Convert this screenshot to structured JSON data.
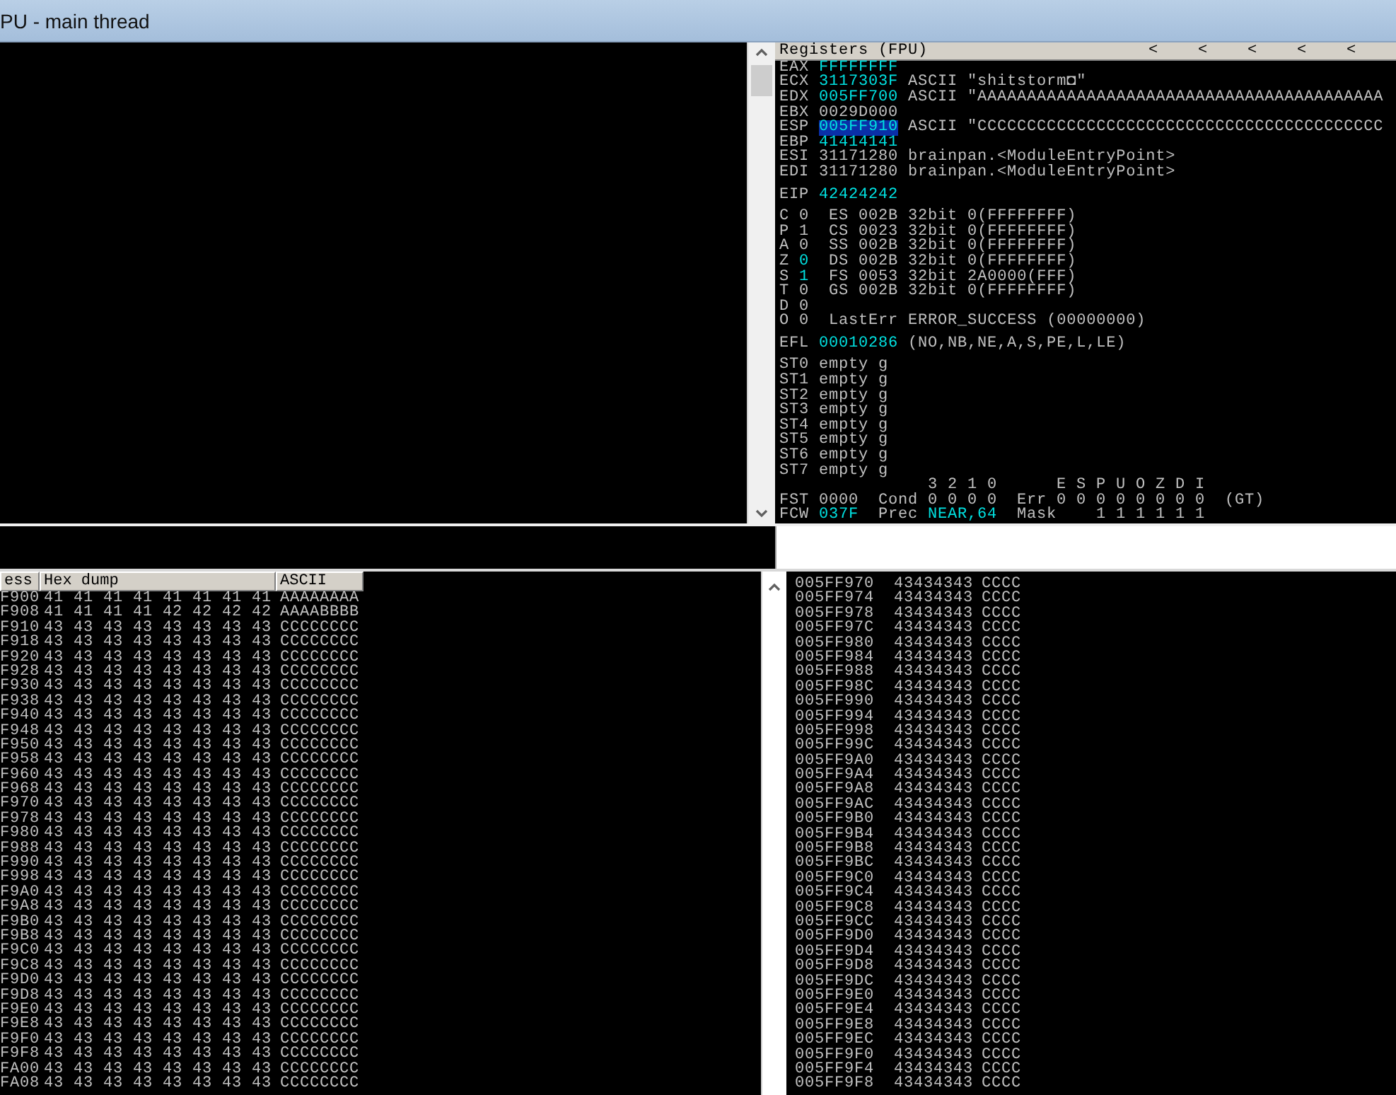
{
  "window": {
    "title": "PU - main thread"
  },
  "registers": {
    "title": "Registers (FPU)",
    "nav_buttons": [
      "<",
      "<",
      "<",
      "<",
      "<"
    ],
    "general": [
      {
        "name": "EAX",
        "value": "FFFFFFFF",
        "changed": true,
        "selected": false
      },
      {
        "name": "ECX",
        "value": "3117303F",
        "changed": true,
        "selected": false,
        "comment": "ASCII \"shitstorm◘\""
      },
      {
        "name": "EDX",
        "value": "005FF700",
        "changed": true,
        "selected": false,
        "comment": "ASCII \"AAAAAAAAAAAAAAAAAAAAAAAAAAAAAAAAAAAAAAAAA"
      },
      {
        "name": "EBX",
        "value": "0029D000",
        "changed": false,
        "selected": false
      },
      {
        "name": "ESP",
        "value": "005FF910",
        "changed": true,
        "selected": true,
        "comment": "ASCII \"CCCCCCCCCCCCCCCCCCCCCCCCCCCCCCCCCCCCCCCCC"
      },
      {
        "name": "EBP",
        "value": "41414141",
        "changed": true,
        "selected": false
      },
      {
        "name": "ESI",
        "value": "31171280",
        "changed": false,
        "selected": false,
        "comment": "brainpan.<ModuleEntryPoint>"
      },
      {
        "name": "EDI",
        "value": "31171280",
        "changed": false,
        "selected": false,
        "comment": "brainpan.<ModuleEntryPoint>"
      }
    ],
    "eip": {
      "name": "EIP",
      "value": "42424242",
      "changed": true
    },
    "flags": [
      {
        "name": "C",
        "value": "0",
        "changed": false,
        "detail": "ES 002B 32bit 0(FFFFFFFF)"
      },
      {
        "name": "P",
        "value": "1",
        "changed": false,
        "detail": "CS 0023 32bit 0(FFFFFFFF)"
      },
      {
        "name": "A",
        "value": "0",
        "changed": false,
        "detail": "SS 002B 32bit 0(FFFFFFFF)"
      },
      {
        "name": "Z",
        "value": "0",
        "changed": true,
        "detail": "DS 002B 32bit 0(FFFFFFFF)"
      },
      {
        "name": "S",
        "value": "1",
        "changed": true,
        "detail": "FS 0053 32bit 2A0000(FFF)"
      },
      {
        "name": "T",
        "value": "0",
        "changed": false,
        "detail": "GS 002B 32bit 0(FFFFFFFF)"
      },
      {
        "name": "D",
        "value": "0",
        "changed": false
      },
      {
        "name": "O",
        "value": "0",
        "changed": false,
        "detail": "LastErr ERROR_SUCCESS (00000000)"
      }
    ],
    "efl": {
      "name": "EFL",
      "value": "00010286",
      "changed": true,
      "decoded": "(NO,NB,NE,A,S,PE,L,LE)"
    },
    "fpu_stack": [
      {
        "name": "ST0",
        "text": "empty g"
      },
      {
        "name": "ST1",
        "text": "empty g"
      },
      {
        "name": "ST2",
        "text": "empty g"
      },
      {
        "name": "ST3",
        "text": "empty g"
      },
      {
        "name": "ST4",
        "text": "empty g"
      },
      {
        "name": "ST5",
        "text": "empty g"
      },
      {
        "name": "ST6",
        "text": "empty g"
      },
      {
        "name": "ST7",
        "text": "empty g"
      }
    ],
    "fpu_status": [
      {
        "segments": [
          {
            "text": "3 2 1 0",
            "changed": false
          },
          {
            "text": "E S P U O Z D I",
            "changed": false
          }
        ]
      },
      {
        "segments": [
          {
            "text": "FST",
            "changed": false
          },
          {
            "text": "0000",
            "changed": false
          },
          {
            "text": "Cond",
            "changed": false
          },
          {
            "text": "0 0 0 0",
            "changed": false
          },
          {
            "text": "Err",
            "changed": false
          },
          {
            "text": "0 0 0 0 0 0 0 0",
            "changed": false
          },
          {
            "text": "(GT)",
            "changed": false
          }
        ]
      },
      {
        "segments": [
          {
            "text": "FCW",
            "changed": false
          },
          {
            "text": "037F",
            "changed": true
          },
          {
            "text": "Prec",
            "changed": false
          },
          {
            "text": "NEAR,64",
            "changed": true
          },
          {
            "text": "Mask",
            "changed": false
          },
          {
            "text": "1 1 1 1 1 1",
            "changed": false
          }
        ]
      }
    ]
  },
  "hex_dump": {
    "columns": [
      "ess",
      "Hex dump",
      "ASCII"
    ],
    "rows": [
      {
        "address": "F900",
        "hex": "41 41 41 41 41 41 41 41",
        "ascii": "AAAAAAAA"
      },
      {
        "address": "F908",
        "hex": "41 41 41 41 42 42 42 42",
        "ascii": "AAAABBBB"
      },
      {
        "address": "F910",
        "hex": "43 43 43 43 43 43 43 43",
        "ascii": "CCCCCCCC"
      },
      {
        "address": "F918",
        "hex": "43 43 43 43 43 43 43 43",
        "ascii": "CCCCCCCC"
      },
      {
        "address": "F920",
        "hex": "43 43 43 43 43 43 43 43",
        "ascii": "CCCCCCCC"
      },
      {
        "address": "F928",
        "hex": "43 43 43 43 43 43 43 43",
        "ascii": "CCCCCCCC"
      },
      {
        "address": "F930",
        "hex": "43 43 43 43 43 43 43 43",
        "ascii": "CCCCCCCC"
      },
      {
        "address": "F938",
        "hex": "43 43 43 43 43 43 43 43",
        "ascii": "CCCCCCCC"
      },
      {
        "address": "F940",
        "hex": "43 43 43 43 43 43 43 43",
        "ascii": "CCCCCCCC"
      },
      {
        "address": "F948",
        "hex": "43 43 43 43 43 43 43 43",
        "ascii": "CCCCCCCC"
      },
      {
        "address": "F950",
        "hex": "43 43 43 43 43 43 43 43",
        "ascii": "CCCCCCCC"
      },
      {
        "address": "F958",
        "hex": "43 43 43 43 43 43 43 43",
        "ascii": "CCCCCCCC"
      },
      {
        "address": "F960",
        "hex": "43 43 43 43 43 43 43 43",
        "ascii": "CCCCCCCC"
      },
      {
        "address": "F968",
        "hex": "43 43 43 43 43 43 43 43",
        "ascii": "CCCCCCCC"
      },
      {
        "address": "F970",
        "hex": "43 43 43 43 43 43 43 43",
        "ascii": "CCCCCCCC"
      },
      {
        "address": "F978",
        "hex": "43 43 43 43 43 43 43 43",
        "ascii": "CCCCCCCC"
      },
      {
        "address": "F980",
        "hex": "43 43 43 43 43 43 43 43",
        "ascii": "CCCCCCCC"
      },
      {
        "address": "F988",
        "hex": "43 43 43 43 43 43 43 43",
        "ascii": "CCCCCCCC"
      },
      {
        "address": "F990",
        "hex": "43 43 43 43 43 43 43 43",
        "ascii": "CCCCCCCC"
      },
      {
        "address": "F998",
        "hex": "43 43 43 43 43 43 43 43",
        "ascii": "CCCCCCCC"
      },
      {
        "address": "F9A0",
        "hex": "43 43 43 43 43 43 43 43",
        "ascii": "CCCCCCCC"
      },
      {
        "address": "F9A8",
        "hex": "43 43 43 43 43 43 43 43",
        "ascii": "CCCCCCCC"
      },
      {
        "address": "F9B0",
        "hex": "43 43 43 43 43 43 43 43",
        "ascii": "CCCCCCCC"
      },
      {
        "address": "F9B8",
        "hex": "43 43 43 43 43 43 43 43",
        "ascii": "CCCCCCCC"
      },
      {
        "address": "F9C0",
        "hex": "43 43 43 43 43 43 43 43",
        "ascii": "CCCCCCCC"
      },
      {
        "address": "F9C8",
        "hex": "43 43 43 43 43 43 43 43",
        "ascii": "CCCCCCCC"
      },
      {
        "address": "F9D0",
        "hex": "43 43 43 43 43 43 43 43",
        "ascii": "CCCCCCCC"
      },
      {
        "address": "F9D8",
        "hex": "43 43 43 43 43 43 43 43",
        "ascii": "CCCCCCCC"
      },
      {
        "address": "F9E0",
        "hex": "43 43 43 43 43 43 43 43",
        "ascii": "CCCCCCCC"
      },
      {
        "address": "F9E8",
        "hex": "43 43 43 43 43 43 43 43",
        "ascii": "CCCCCCCC"
      },
      {
        "address": "F9F0",
        "hex": "43 43 43 43 43 43 43 43",
        "ascii": "CCCCCCCC"
      },
      {
        "address": "F9F8",
        "hex": "43 43 43 43 43 43 43 43",
        "ascii": "CCCCCCCC"
      },
      {
        "address": "FA00",
        "hex": "43 43 43 43 43 43 43 43",
        "ascii": "CCCCCCCC"
      },
      {
        "address": "FA08",
        "hex": "43 43 43 43 43 43 43 43",
        "ascii": "CCCCCCCC"
      }
    ]
  },
  "stack": {
    "rows": [
      {
        "address": "005FF970",
        "value": "43434343",
        "comment": "CCCC"
      },
      {
        "address": "005FF974",
        "value": "43434343",
        "comment": "CCCC"
      },
      {
        "address": "005FF978",
        "value": "43434343",
        "comment": "CCCC"
      },
      {
        "address": "005FF97C",
        "value": "43434343",
        "comment": "CCCC"
      },
      {
        "address": "005FF980",
        "value": "43434343",
        "comment": "CCCC"
      },
      {
        "address": "005FF984",
        "value": "43434343",
        "comment": "CCCC"
      },
      {
        "address": "005FF988",
        "value": "43434343",
        "comment": "CCCC"
      },
      {
        "address": "005FF98C",
        "value": "43434343",
        "comment": "CCCC"
      },
      {
        "address": "005FF990",
        "value": "43434343",
        "comment": "CCCC"
      },
      {
        "address": "005FF994",
        "value": "43434343",
        "comment": "CCCC"
      },
      {
        "address": "005FF998",
        "value": "43434343",
        "comment": "CCCC"
      },
      {
        "address": "005FF99C",
        "value": "43434343",
        "comment": "CCCC"
      },
      {
        "address": "005FF9A0",
        "value": "43434343",
        "comment": "CCCC"
      },
      {
        "address": "005FF9A4",
        "value": "43434343",
        "comment": "CCCC"
      },
      {
        "address": "005FF9A8",
        "value": "43434343",
        "comment": "CCCC"
      },
      {
        "address": "005FF9AC",
        "value": "43434343",
        "comment": "CCCC"
      },
      {
        "address": "005FF9B0",
        "value": "43434343",
        "comment": "CCCC"
      },
      {
        "address": "005FF9B4",
        "value": "43434343",
        "comment": "CCCC"
      },
      {
        "address": "005FF9B8",
        "value": "43434343",
        "comment": "CCCC"
      },
      {
        "address": "005FF9BC",
        "value": "43434343",
        "comment": "CCCC"
      },
      {
        "address": "005FF9C0",
        "value": "43434343",
        "comment": "CCCC"
      },
      {
        "address": "005FF9C4",
        "value": "43434343",
        "comment": "CCCC"
      },
      {
        "address": "005FF9C8",
        "value": "43434343",
        "comment": "CCCC"
      },
      {
        "address": "005FF9CC",
        "value": "43434343",
        "comment": "CCCC"
      },
      {
        "address": "005FF9D0",
        "value": "43434343",
        "comment": "CCCC"
      },
      {
        "address": "005FF9D4",
        "value": "43434343",
        "comment": "CCCC"
      },
      {
        "address": "005FF9D8",
        "value": "43434343",
        "comment": "CCCC"
      },
      {
        "address": "005FF9DC",
        "value": "43434343",
        "comment": "CCCC"
      },
      {
        "address": "005FF9E0",
        "value": "43434343",
        "comment": "CCCC"
      },
      {
        "address": "005FF9E4",
        "value": "43434343",
        "comment": "CCCC"
      },
      {
        "address": "005FF9E8",
        "value": "43434343",
        "comment": "CCCC"
      },
      {
        "address": "005FF9EC",
        "value": "43434343",
        "comment": "CCCC"
      },
      {
        "address": "005FF9F0",
        "value": "43434343",
        "comment": "CCCC"
      },
      {
        "address": "005FF9F4",
        "value": "43434343",
        "comment": "CCCC"
      },
      {
        "address": "005FF9F8",
        "value": "43434343",
        "comment": "CCCC"
      }
    ]
  }
}
